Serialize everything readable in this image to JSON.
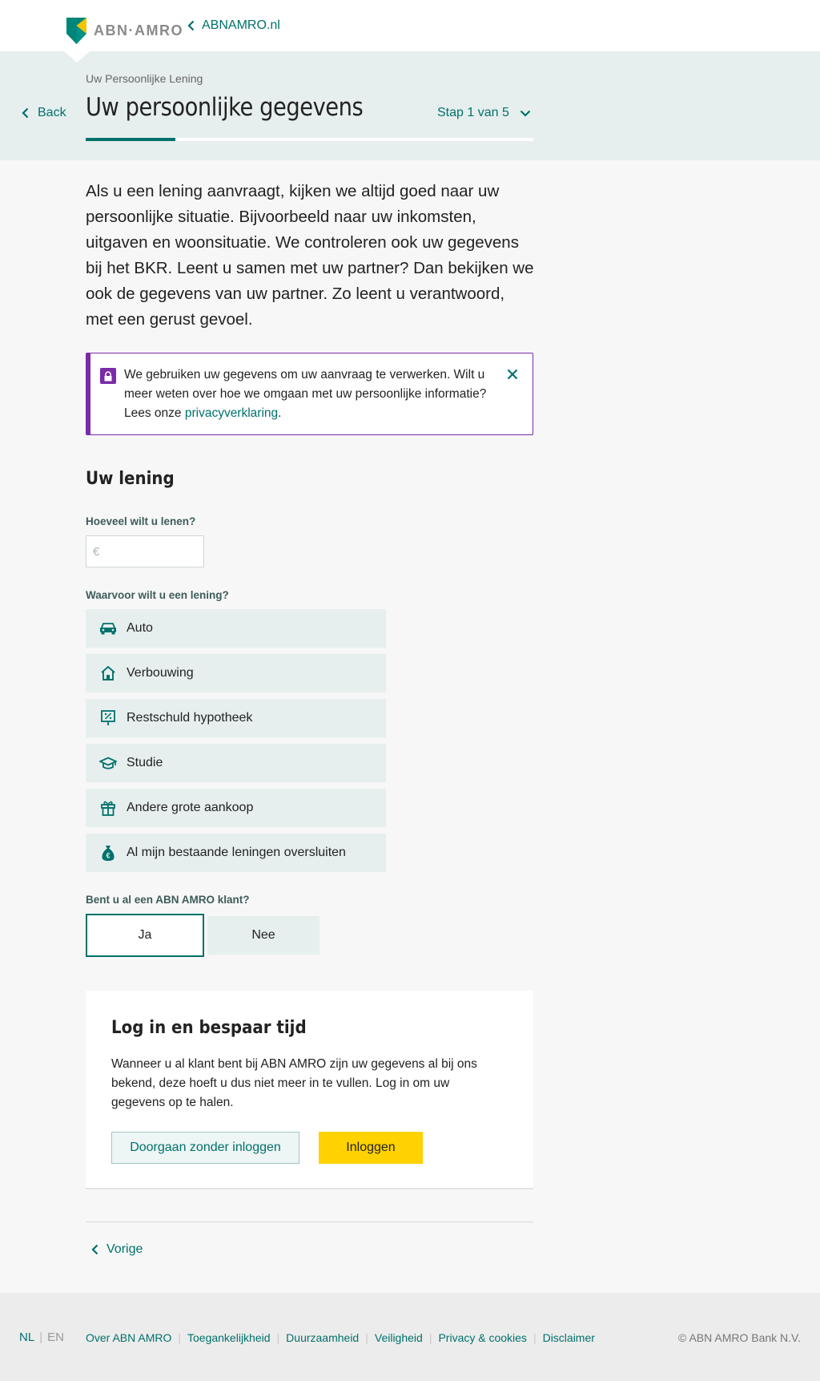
{
  "topbar": {
    "brand": "ABN·AMRO",
    "back_link": "ABNAMRO.nl"
  },
  "header": {
    "breadcrumb": "Uw Persoonlijke Lening",
    "title": "Uw persoonlijke gegevens",
    "back_label": "Back",
    "step_label": "Stap 1 van 5",
    "progress_fraction": 0.2
  },
  "intro": "Als u een lening aanvraagt, kijken we altijd goed naar uw persoonlijke situatie. Bijvoorbeeld naar uw inkomsten, uitgaven en woonsituatie. We controleren ook uw gegevens bij het BKR. Leent u samen met uw partner? Dan bekijken we ook de gegevens van uw partner. Zo leent u verantwoord, met een gerust gevoel.",
  "notice": {
    "text_before": "We gebruiken uw gegevens om uw aanvraag te verwerken. Wilt u meer weten over hoe we omgaan met uw persoonlijke informatie? Lees onze ",
    "link": "privacyverklaring",
    "text_after": "."
  },
  "loan": {
    "section_title": "Uw lening",
    "amount_label": "Hoeveel wilt u lenen?",
    "amount_prefix": "€",
    "amount_value": "",
    "purpose_label": "Waarvoor wilt u een lening?",
    "purposes": [
      {
        "label": "Auto",
        "icon": "car-icon"
      },
      {
        "label": "Verbouwing",
        "icon": "house-icon"
      },
      {
        "label": "Restschuld hypotheek",
        "icon": "percent-sign-icon"
      },
      {
        "label": "Studie",
        "icon": "graduation-cap-icon"
      },
      {
        "label": "Andere grote aankoop",
        "icon": "gift-icon"
      },
      {
        "label": "Al mijn bestaande leningen oversluiten",
        "icon": "money-bag-icon"
      }
    ],
    "customer_label": "Bent u al een ABN AMRO klant?",
    "yes": "Ja",
    "no": "Nee",
    "selected": "Ja"
  },
  "login_card": {
    "title": "Log in en bespaar tijd",
    "text": "Wanneer u al klant bent bij ABN AMRO zijn uw gegevens al bij ons bekend, deze hoeft u dus niet meer in te vullen. Log in om uw gegevens op te halen.",
    "secondary_button": "Doorgaan zonder inloggen",
    "primary_button": "Inloggen"
  },
  "nav": {
    "previous": "Vorige"
  },
  "footer": {
    "lang_nl": "NL",
    "lang_en": "EN",
    "links": [
      "Over ABN AMRO",
      "Toegankelijkheid",
      "Duurzaamheid",
      "Veiligheid",
      "Privacy & cookies",
      "Disclaimer"
    ],
    "copyright": "© ABN AMRO Bank N.V."
  },
  "colors": {
    "brand_green": "#00716b",
    "header_bg": "#e6efee",
    "notice_purple": "#7b2aa8",
    "login_yellow": "#ffd200"
  }
}
